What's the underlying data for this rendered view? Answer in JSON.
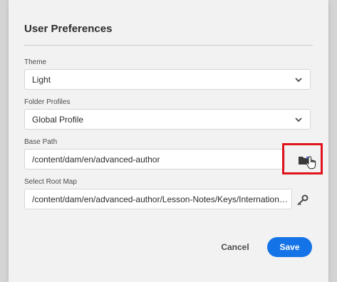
{
  "dialog": {
    "title": "User Preferences"
  },
  "theme": {
    "label": "Theme",
    "value": "Light"
  },
  "folder_profiles": {
    "label": "Folder Profiles",
    "value": "Global Profile"
  },
  "base_path": {
    "label": "Base Path",
    "value": "/content/dam/en/advanced-author",
    "browse_icon": "folder-icon"
  },
  "root_map": {
    "label": "Select Root Map",
    "value": "/content/dam/en/advanced-author/Lesson-Notes/Keys/International...",
    "browse_icon": "key-icon"
  },
  "footer": {
    "cancel_label": "Cancel",
    "save_label": "Save"
  },
  "colors": {
    "accent": "#1473e6",
    "highlight": "#e0131f",
    "background": "#f2f2f2"
  }
}
